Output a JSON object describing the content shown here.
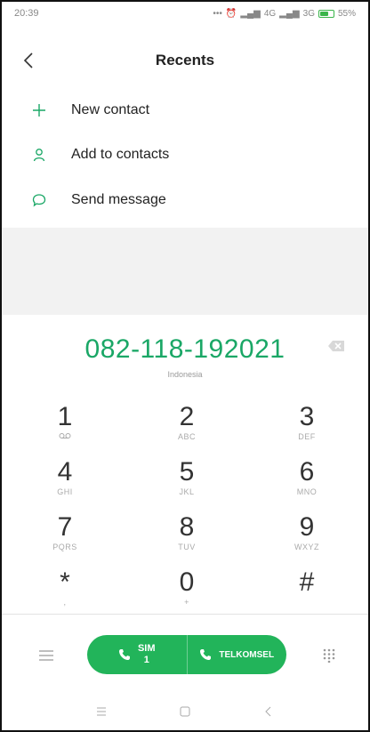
{
  "status": {
    "time": "20:39",
    "network1": "4G",
    "network2": "3G",
    "battery": "55%"
  },
  "header": {
    "title": "Recents"
  },
  "menu": [
    {
      "label": "New contact",
      "icon": "plus-icon"
    },
    {
      "label": "Add to contacts",
      "icon": "person-icon"
    },
    {
      "label": "Send message",
      "icon": "message-icon"
    }
  ],
  "dialer": {
    "number": "082-118-192021",
    "region": "Indonesia"
  },
  "keys": [
    {
      "num": "1",
      "sub": ""
    },
    {
      "num": "2",
      "sub": "ABC"
    },
    {
      "num": "3",
      "sub": "DEF"
    },
    {
      "num": "4",
      "sub": "GHI"
    },
    {
      "num": "5",
      "sub": "JKL"
    },
    {
      "num": "6",
      "sub": "MNO"
    },
    {
      "num": "7",
      "sub": "PQRS"
    },
    {
      "num": "8",
      "sub": "TUV"
    },
    {
      "num": "9",
      "sub": "WXYZ"
    },
    {
      "num": "*",
      "sub": ","
    },
    {
      "num": "0",
      "sub": "+"
    },
    {
      "num": "#",
      "sub": ""
    }
  ],
  "call": {
    "sim_label": "SIM",
    "sim_number": "1",
    "carrier": "TELKOMSEL"
  },
  "colors": {
    "accent": "#1aa766",
    "call_bg": "#22b45a"
  }
}
